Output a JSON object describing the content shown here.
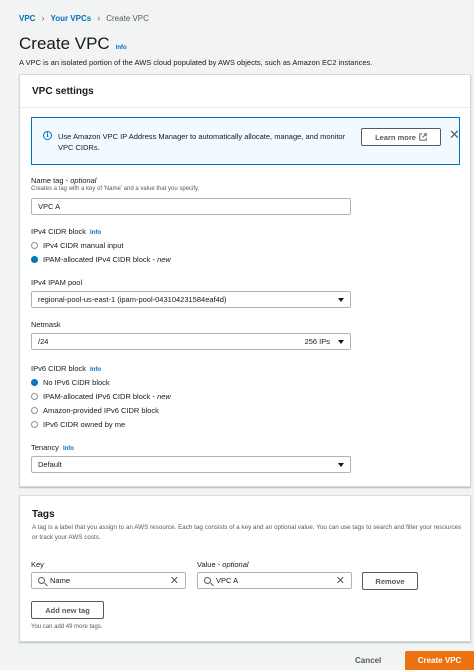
{
  "breadcrumb": {
    "item1": "VPC",
    "item2": "Your VPCs",
    "current": "Create VPC"
  },
  "page": {
    "title": "Create VPC",
    "info": "Info",
    "description": "A VPC is an isolated portion of the AWS cloud populated by AWS objects, such as Amazon EC2 instances."
  },
  "vpc_settings": {
    "header": "VPC settings",
    "banner": {
      "text": "Use Amazon VPC IP Address Manager to automatically allocate, manage, and monitor VPC CIDRs.",
      "learn_more": "Learn more"
    },
    "name_tag": {
      "label": "Name tag - ",
      "label_opt": "optional",
      "description": "Creates a tag with a key of 'Name' and a value that you specify.",
      "value": "VPC A"
    },
    "ipv4_cidr": {
      "label": "IPv4 CIDR block",
      "info": "Info",
      "options": [
        {
          "label": "IPv4 CIDR manual input",
          "suffix": "",
          "selected": false
        },
        {
          "label": "IPAM-allocated IPv4 CIDR block - ",
          "suffix": "new",
          "selected": true
        }
      ]
    },
    "ipam_pool": {
      "label": "IPv4 IPAM pool",
      "value": "regional-pool-us-east-1 (ipam-pool-043104231584eaf4d)"
    },
    "netmask": {
      "label": "Netmask",
      "value": "/24",
      "ips": "256 IPs"
    },
    "ipv6_cidr": {
      "label": "IPv6 CIDR block",
      "info": "Info",
      "options": [
        {
          "label": "No IPv6 CIDR block",
          "suffix": "",
          "selected": true
        },
        {
          "label": "IPAM-allocated IPv6 CIDR block - ",
          "suffix": "new",
          "selected": false
        },
        {
          "label": "Amazon-provided IPv6 CIDR block",
          "suffix": "",
          "selected": false
        },
        {
          "label": "IPv6 CIDR owned by me",
          "suffix": "",
          "selected": false
        }
      ]
    },
    "tenancy": {
      "label": "Tenancy",
      "info": "Info",
      "value": "Default"
    }
  },
  "tags": {
    "title": "Tags",
    "description": "A tag is a label that you assign to an AWS resource. Each tag consists of a key and an optional value. You can use tags to search and filter your resources or track your AWS costs.",
    "key_label": "Key",
    "value_label": "Value - ",
    "value_label_opt": "optional",
    "key_value": "Name",
    "value_value": "VPC A",
    "remove": "Remove",
    "add_new": "Add new tag",
    "remaining": "You can add 49 more tags."
  },
  "footer": {
    "cancel": "Cancel",
    "create": "Create VPC"
  },
  "colors": {
    "link": "#0073bb",
    "primary": "#ec7211",
    "border": "#aab7b8"
  },
  "icons": [
    "chevron-right-icon",
    "info-circle-icon",
    "external-link-icon",
    "close-icon",
    "caret-down-icon",
    "search-icon",
    "clear-icon"
  ]
}
